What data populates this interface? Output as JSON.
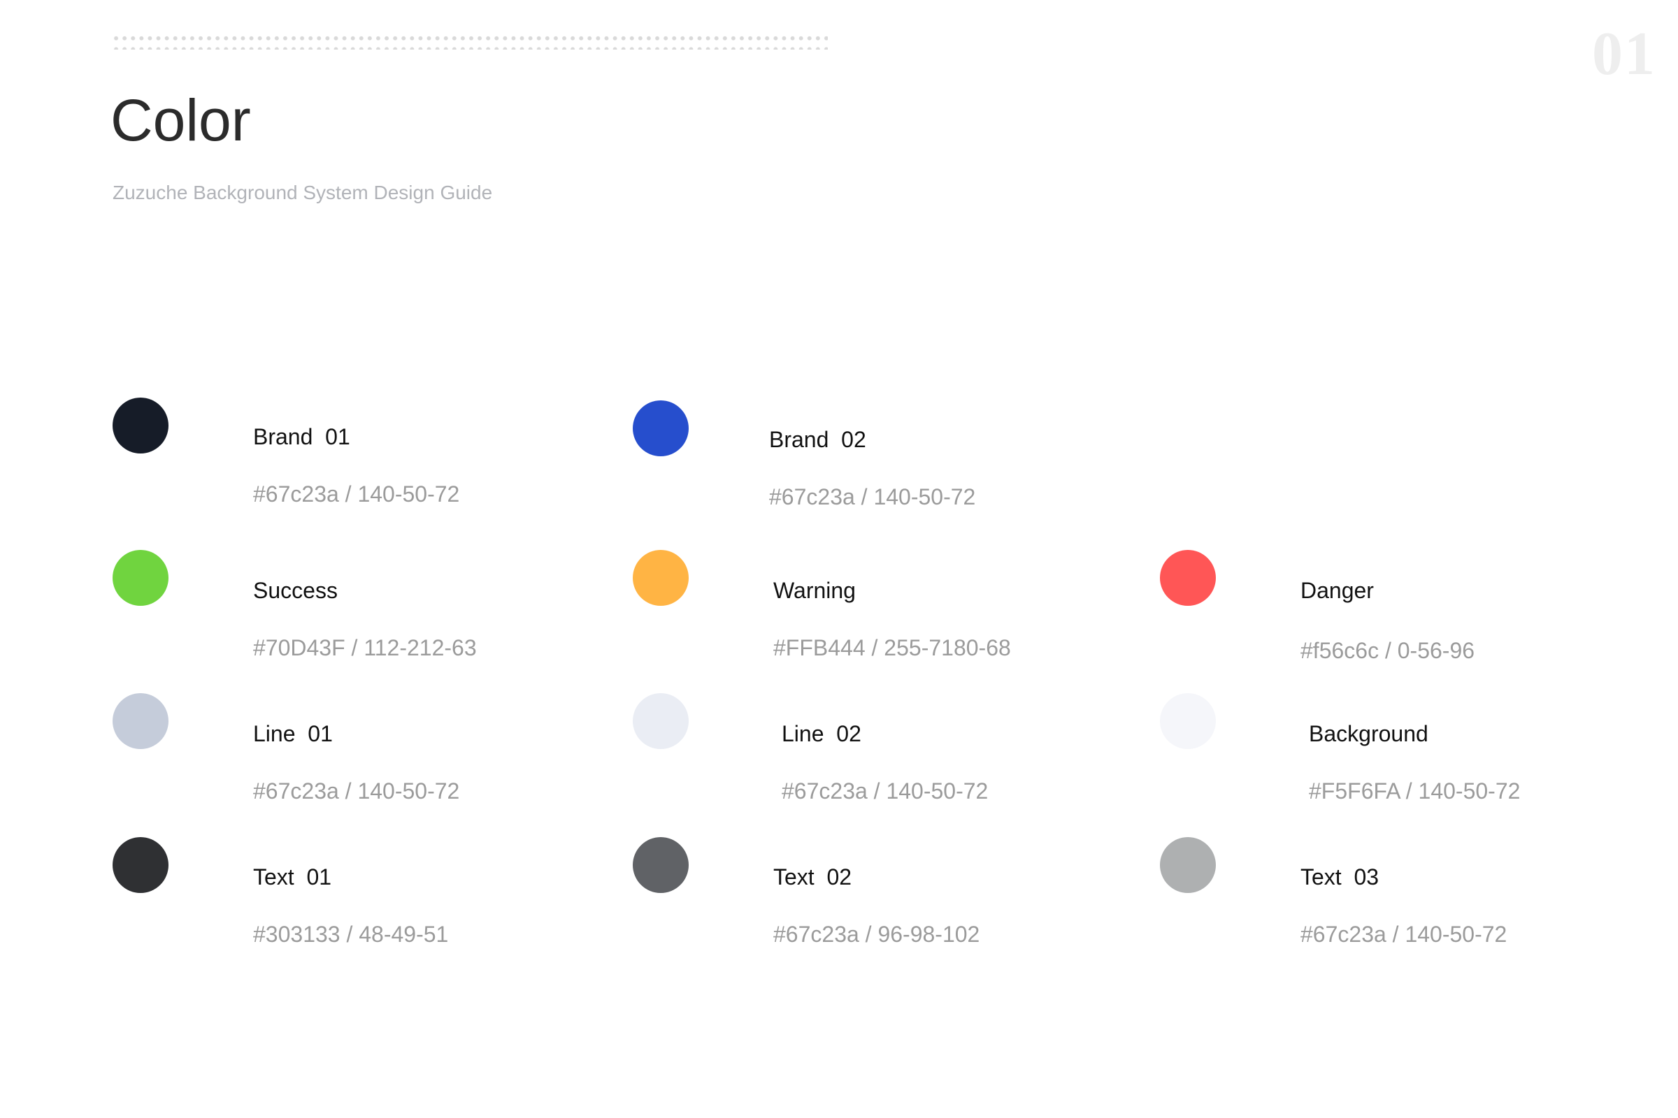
{
  "header": {
    "page_number": "01",
    "title": "Color",
    "subtitle": "Zuzuche Background System Design Guide"
  },
  "colors": [
    {
      "name": "Brand  01",
      "code": "#67c23a / 140-50-72",
      "swatch": "#161c28"
    },
    {
      "name": "Brand  02",
      "code": "#67c23a / 140-50-72",
      "swatch": "#264ecd"
    },
    {
      "name": "Success",
      "code": "#70D43F / 112-212-63",
      "swatch": "#70d43f"
    },
    {
      "name": "Warning",
      "code": "#FFB444 / 255-7180-68",
      "swatch": "#ffb444"
    },
    {
      "name": "Danger",
      "code": "#f56c6c / 0-56-96",
      "swatch": "#ff5656"
    },
    {
      "name": "Line  01",
      "code": "#67c23a / 140-50-72",
      "swatch": "#c5ccda"
    },
    {
      "name": "Line  02",
      "code": "#67c23a / 140-50-72",
      "swatch": "#eaedf4"
    },
    {
      "name": "Background",
      "code": "#F5F6FA / 140-50-72",
      "swatch": "#f5f6fa"
    },
    {
      "name": "Text  01",
      "code": "#303133 / 48-49-51",
      "swatch": "#2f3033"
    },
    {
      "name": "Text  02",
      "code": "#67c23a / 96-98-102",
      "swatch": "#606266"
    },
    {
      "name": "Text  03",
      "code": "#67c23a / 140-50-72",
      "swatch": "#aeb0b1"
    }
  ]
}
